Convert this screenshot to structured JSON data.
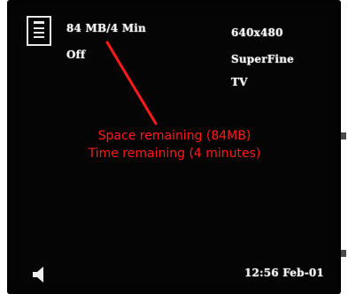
{
  "memory": {
    "remaining": "84 MB/4 Min",
    "mode": "Off"
  },
  "settings": {
    "resolution": "640x480",
    "quality": "SuperFine",
    "output": "TV"
  },
  "annotation": {
    "line1": "Space remaining (84MB)",
    "line2": "Time remaining (4 minutes)",
    "color": "#ff1a1a"
  },
  "clock": {
    "datetime": "12:56 Feb-01"
  },
  "icons": {
    "storage": "memory-card-icon",
    "audio": "speaker-icon"
  }
}
